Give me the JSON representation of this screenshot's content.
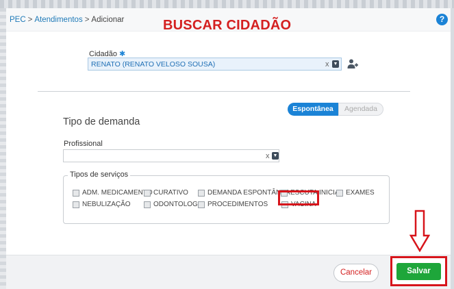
{
  "breadcrumb": {
    "item1": "PEC",
    "item2": "Atendimentos",
    "current": "Adicionar",
    "separator": ">"
  },
  "help_label": "?",
  "annotation_title": "BUSCAR CIDADÃO",
  "cidadao": {
    "label": "Cidadão",
    "required_mark": "✱",
    "value": "RENATO (RENATO VELOSO SOUSA)",
    "clear_symbol": "x"
  },
  "tipo_demanda": {
    "label": "Tipo de demanda",
    "options": [
      "Espontânea",
      "Agendada"
    ],
    "selected": "Espontânea"
  },
  "profissional": {
    "label": "Profissional",
    "value": "",
    "clear_symbol": "x"
  },
  "tipos_servicos": {
    "legend": "Tipos de serviços",
    "items": [
      "ADM. MEDICAMENTO",
      "CURATIVO",
      "DEMANDA ESPONTÂNEA",
      "ESCUTA INICIAL",
      "EXAMES",
      "NEBULIZAÇÃO",
      "ODONTOLOGIA",
      "PROCEDIMENTOS",
      "VACINA"
    ]
  },
  "footer": {
    "cancel_label": "Cancelar",
    "save_label": "Salvar"
  },
  "colors": {
    "primary": "#1b83d6",
    "annotation_red": "#d7141b",
    "save_green": "#1ea63a",
    "link_blue": "#1f7ab8"
  },
  "icons": [
    "help-icon",
    "chevron-down-icon",
    "add-user-icon",
    "red-arrow-down-icon"
  ]
}
